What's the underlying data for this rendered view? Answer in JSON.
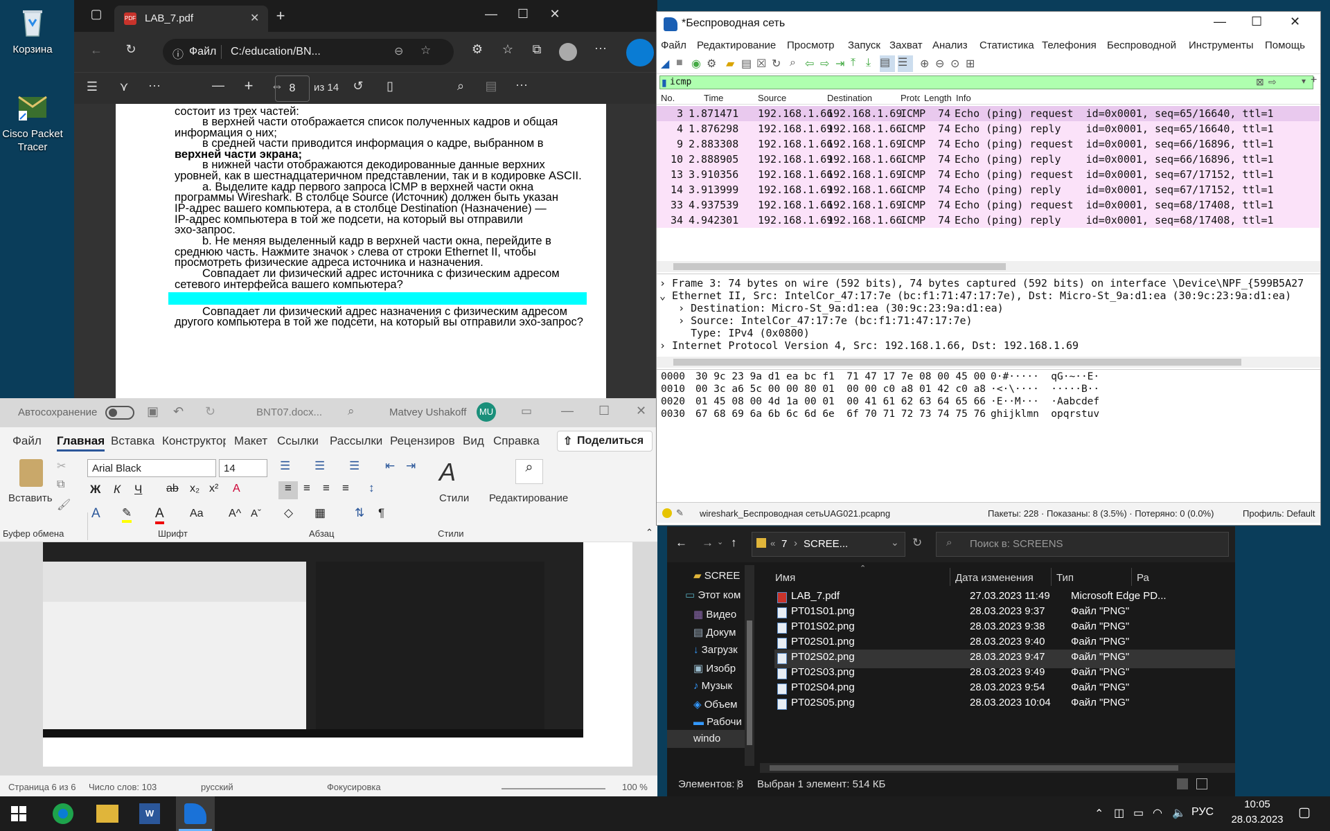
{
  "desktop": {
    "icons": [
      {
        "label": "Корзина"
      },
      {
        "label": "Cisco Packet Tracer"
      }
    ]
  },
  "edge": {
    "tab_title": "LAB_7.pdf",
    "file_label": "Файл",
    "address": "C:/education/BN...",
    "page_num": "8",
    "page_total": "из 14",
    "pdf_lines": [
      {
        "text": "состоит из трех частей:"
      },
      {
        "text": "в верхней части отображается список полученных кадров и общая"
      },
      {
        "text": "информация о них;"
      },
      {
        "text": "в средней части приводится информация о кадре, выбранном в"
      },
      {
        "text": "верхней части экрана;"
      },
      {
        "text": "в нижней части отображаются декодированные данные верхних"
      },
      {
        "text": "уровней, как в шестнадцатеричном представлении, так и в кодировке ASCII."
      },
      {
        "text": "a. Выделите кадр первого запроса ICMP в верхней части окна"
      },
      {
        "text": "программы Wireshark. В столбце Source (Источник) должен быть указан"
      },
      {
        "text": "IP-адрес вашего компьютера, а в столбце Destination (Назначение) —"
      },
      {
        "text": "IP-адрес компьютера в той же подсети, на который вы отправили"
      },
      {
        "text": "эхо-запрос."
      },
      {
        "text": "b. Не меняя выделенный кадр в верхней части окна, перейдите в"
      },
      {
        "text": "среднюю часть. Нажмите значок › слева от строки Ethernet II, чтобы"
      },
      {
        "text": "просмотреть физические адреса источника и назначения."
      },
      {
        "text": "Совпадает ли физический адрес источника с физическим адресом"
      },
      {
        "text": "сетевого интерфейса вашего компьютера?"
      },
      {
        "text": "Совпадает ли физический адрес назначения с физическим адресом"
      },
      {
        "text": "другого компьютера в той же подсети, на который вы отправили эхо-запрос?"
      }
    ]
  },
  "word": {
    "autosave": "Автосохранение",
    "doc": "BNT07.docx...",
    "user": "Matvey Ushakoff",
    "user_initials": "MU",
    "tabs": [
      "Файл",
      "Главная",
      "Вставка",
      "Конструктор",
      "Макет",
      "Ссылки",
      "Рассылки",
      "Рецензиров",
      "Вид",
      "Справка"
    ],
    "share": "Поделиться",
    "paste": "Вставить",
    "font": "Arial Black",
    "size": "14",
    "styles": "Стили",
    "editing": "Редактирование",
    "groups": [
      "Буфер обмена",
      "Шрифт",
      "Абзац",
      "Стили"
    ],
    "status": {
      "page": "Страница 6 из 6",
      "words": "Число слов: 103",
      "lang": "русский",
      "focus": "Фокусировка",
      "zoom": "100 %"
    }
  },
  "ws": {
    "title": "*Беспроводная сеть",
    "menu": [
      "Файл",
      "Редактирование",
      "Просмотр",
      "Запуск",
      "Захват",
      "Анализ",
      "Статистика",
      "Телефония",
      "Беспроводной",
      "Инструменты",
      "Помощь"
    ],
    "filter": "icmp",
    "columns": [
      "No.",
      "Time",
      "Source",
      "Destination",
      "Protocol",
      "Length",
      "Info"
    ],
    "packets": [
      {
        "no": "3",
        "time": "1.871471",
        "src": "192.168.1.66",
        "dst": "192.168.1.69",
        "proto": "ICMP",
        "len": "74",
        "info": "Echo (ping) request  id=0x0001, seq=65/16640, ttl=1"
      },
      {
        "no": "4",
        "time": "1.876298",
        "src": "192.168.1.69",
        "dst": "192.168.1.66",
        "proto": "ICMP",
        "len": "74",
        "info": "Echo (ping) reply    id=0x0001, seq=65/16640, ttl=1"
      },
      {
        "no": "9",
        "time": "2.883308",
        "src": "192.168.1.66",
        "dst": "192.168.1.69",
        "proto": "ICMP",
        "len": "74",
        "info": "Echo (ping) request  id=0x0001, seq=66/16896, ttl=1"
      },
      {
        "no": "10",
        "time": "2.888905",
        "src": "192.168.1.69",
        "dst": "192.168.1.66",
        "proto": "ICMP",
        "len": "74",
        "info": "Echo (ping) reply    id=0x0001, seq=66/16896, ttl=1"
      },
      {
        "no": "13",
        "time": "3.910356",
        "src": "192.168.1.66",
        "dst": "192.168.1.69",
        "proto": "ICMP",
        "len": "74",
        "info": "Echo (ping) request  id=0x0001, seq=67/17152, ttl=1"
      },
      {
        "no": "14",
        "time": "3.913999",
        "src": "192.168.1.69",
        "dst": "192.168.1.66",
        "proto": "ICMP",
        "len": "74",
        "info": "Echo (ping) reply    id=0x0001, seq=67/17152, ttl=1"
      },
      {
        "no": "33",
        "time": "4.937539",
        "src": "192.168.1.66",
        "dst": "192.168.1.69",
        "proto": "ICMP",
        "len": "74",
        "info": "Echo (ping) request  id=0x0001, seq=68/17408, ttl=1"
      },
      {
        "no": "34",
        "time": "4.942301",
        "src": "192.168.1.69",
        "dst": "192.168.1.66",
        "proto": "ICMP",
        "len": "74",
        "info": "Echo (ping) reply    id=0x0001, seq=68/17408, ttl=1"
      }
    ],
    "details": [
      "› Frame 3: 74 bytes on wire (592 bits), 74 bytes captured (592 bits) on interface \\Device\\NPF_{599B5A27",
      "⌄ Ethernet II, Src: IntelCor_47:17:7e (bc:f1:71:47:17:7e), Dst: Micro-St_9a:d1:ea (30:9c:23:9a:d1:ea)",
      "   › Destination: Micro-St_9a:d1:ea (30:9c:23:9a:d1:ea)",
      "   › Source: IntelCor_47:17:7e (bc:f1:71:47:17:7e)",
      "     Type: IPv4 (0x0800)",
      "› Internet Protocol Version 4, Src: 192.168.1.66, Dst: 192.168.1.69"
    ],
    "hex": [
      {
        "off": "0000",
        "bytes": "30 9c 23 9a d1 ea bc f1  71 47 17 7e 08 00 45 00",
        "ascii": "0·#·····  qG·~··E·"
      },
      {
        "off": "0010",
        "bytes": "00 3c a6 5c 00 00 80 01  00 00 c0 a8 01 42 c0 a8",
        "ascii": "·<·\\····  ·····B··"
      },
      {
        "off": "0020",
        "bytes": "01 45 08 00 4d 1a 00 01  00 41 61 62 63 64 65 66",
        "ascii": "·E··M···  ·Aabcdef"
      },
      {
        "off": "0030",
        "bytes": "67 68 69 6a 6b 6c 6d 6e  6f 70 71 72 73 74 75 76",
        "ascii": "ghijklmn  opqrstuv"
      }
    ],
    "status_file": "wireshark_Беспроводная сетьUAG021.pcapng",
    "status_stats": "Пакеты: 228 · Показаны: 8 (3.5%) · Потеряно: 0 (0.0%)",
    "status_profile": "Профиль: Default"
  },
  "explorer": {
    "path_num": "7",
    "path": "SCREE...",
    "search": "Поиск в: SCREENS",
    "nav": [
      "SCREE",
      "Этот ком",
      "Видео",
      "Докум",
      "Загрузк",
      "Изобр",
      "Музык",
      "Объем",
      "Рабочи",
      "windo"
    ],
    "cols": [
      "Имя",
      "Дата изменения",
      "Тип",
      "Ра"
    ],
    "files": [
      {
        "name": "LAB_7.pdf",
        "date": "27.03.2023 11:49",
        "type": "Microsoft Edge PD..."
      },
      {
        "name": "PT01S01.png",
        "date": "28.03.2023 9:37",
        "type": "Файл \"PNG\""
      },
      {
        "name": "PT01S02.png",
        "date": "28.03.2023 9:38",
        "type": "Файл \"PNG\""
      },
      {
        "name": "PT02S01.png",
        "date": "28.03.2023 9:40",
        "type": "Файл \"PNG\""
      },
      {
        "name": "PT02S02.png",
        "date": "28.03.2023 9:47",
        "type": "Файл \"PNG\""
      },
      {
        "name": "PT02S03.png",
        "date": "28.03.2023 9:49",
        "type": "Файл \"PNG\""
      },
      {
        "name": "PT02S04.png",
        "date": "28.03.2023 9:54",
        "type": "Файл \"PNG\""
      },
      {
        "name": "PT02S05.png",
        "date": "28.03.2023 10:04",
        "type": "Файл \"PNG\""
      }
    ],
    "status_count": "Элементов: 8",
    "status_sel": "Выбран 1 элемент: 514 КБ"
  },
  "taskbar": {
    "lang": "РУС",
    "time": "10:05",
    "date": "28.03.2023"
  }
}
